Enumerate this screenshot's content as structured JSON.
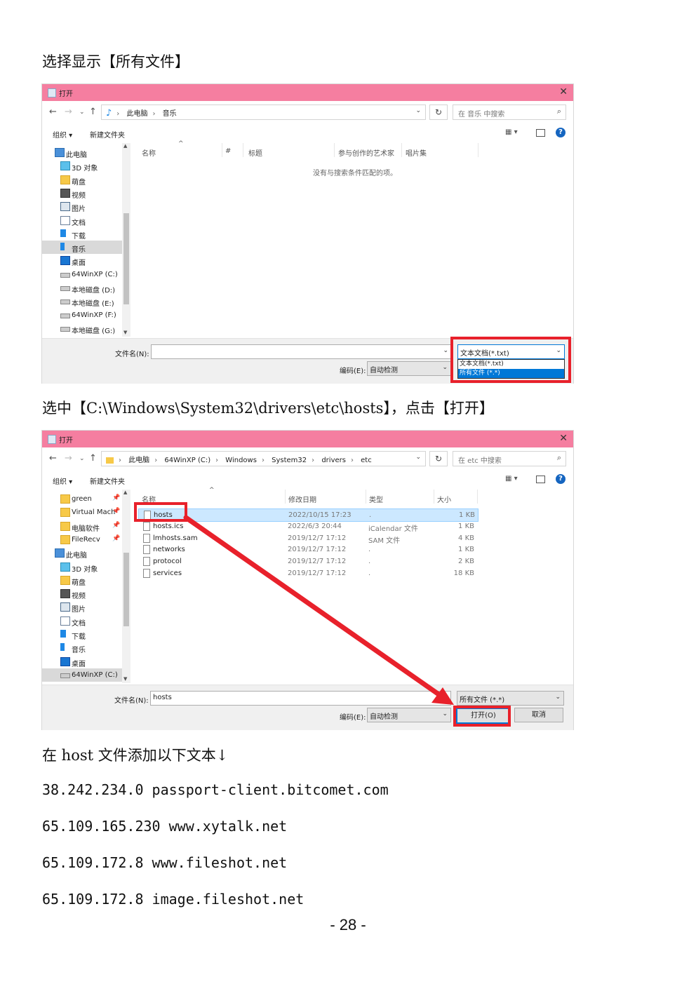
{
  "captions": {
    "c1": "选择显示【所有文件】",
    "c2": "选中【C:\\Windows\\System32\\drivers\\etc\\hosts】，点击【打开】",
    "c3": "在 host 文件添加以下文本↓"
  },
  "host_lines": [
    "38.242.234.0 passport-client.bitcomet.com",
    "65.109.165.230 www.xytalk.net",
    "65.109.172.8 www.fileshot.net",
    "65.109.172.8 image.fileshot.net"
  ],
  "page_number": "- 28 -",
  "colors": {
    "titlebar": "#f57ea0",
    "highlight_box": "#e8212b",
    "selection": "#0078d7"
  },
  "dialog1": {
    "title": "打开",
    "close": "✕",
    "nav": {
      "back": "←",
      "forward": "→",
      "recent": "⌄",
      "up": "↑"
    },
    "path": [
      "此电脑",
      "音乐"
    ],
    "refresh": "↻",
    "search_placeholder": "在 音乐 中搜索",
    "toolbar": {
      "organize": "组织 ▾",
      "new_folder": "新建文件夹",
      "views": "▦ ▾",
      "help": "?"
    },
    "sidebar": [
      {
        "label": "此电脑",
        "icon": "computer-icon"
      },
      {
        "label": "3D 对象",
        "icon": "cube-icon"
      },
      {
        "label": "萌盘",
        "icon": "folder-icon"
      },
      {
        "label": "视频",
        "icon": "video-icon"
      },
      {
        "label": "图片",
        "icon": "picture-icon"
      },
      {
        "label": "文档",
        "icon": "document-icon"
      },
      {
        "label": "下载",
        "icon": "download-icon"
      },
      {
        "label": "音乐",
        "icon": "music-icon",
        "selected": true
      },
      {
        "label": "桌面",
        "icon": "desktop-icon"
      },
      {
        "label": "64WinXP  (C:)",
        "icon": "drive-icon"
      },
      {
        "label": "本地磁盘 (D:)",
        "icon": "drive-icon"
      },
      {
        "label": "本地磁盘 (E:)",
        "icon": "drive-icon"
      },
      {
        "label": "64WinXP  (F:)",
        "icon": "drive-icon"
      },
      {
        "label": "本地磁盘 (G:)",
        "icon": "drive-icon"
      }
    ],
    "columns": [
      "名称",
      "#",
      "标题",
      "参与创作的艺术家",
      "唱片集"
    ],
    "empty_message": "没有与搜索条件匹配的项。",
    "filename_label": "文件名(N):",
    "filename_value": "",
    "filetype_value": "文本文档(*.txt)",
    "filetype_options": [
      "文本文档(*.txt)",
      "所有文件  (*.*)"
    ],
    "encoding_label": "编码(E):",
    "encoding_value": "自动检测"
  },
  "dialog2": {
    "title": "打开",
    "close": "✕",
    "nav": {
      "back": "←",
      "forward": "→",
      "recent": "⌄",
      "up": "↑"
    },
    "path": [
      "此电脑",
      "64WinXP  (C:)",
      "Windows",
      "System32",
      "drivers",
      "etc"
    ],
    "refresh": "↻",
    "search_placeholder": "在 etc 中搜索",
    "toolbar": {
      "organize": "组织 ▾",
      "new_folder": "新建文件夹",
      "views": "▦ ▾",
      "help": "?"
    },
    "sidebar": [
      {
        "label": "green",
        "icon": "folder-icon",
        "pinned": true
      },
      {
        "label": "Virtual Mach",
        "icon": "folder-icon",
        "pinned": true
      },
      {
        "label": "电脑软件",
        "icon": "folder-icon",
        "pinned": true
      },
      {
        "label": "FileRecv",
        "icon": "folder-icon",
        "pinned": true
      },
      {
        "label": "此电脑",
        "icon": "computer-icon"
      },
      {
        "label": "3D 对象",
        "icon": "cube-icon"
      },
      {
        "label": "萌盘",
        "icon": "folder-icon"
      },
      {
        "label": "视频",
        "icon": "video-icon"
      },
      {
        "label": "图片",
        "icon": "picture-icon"
      },
      {
        "label": "文档",
        "icon": "document-icon"
      },
      {
        "label": "下载",
        "icon": "download-icon"
      },
      {
        "label": "音乐",
        "icon": "music-icon"
      },
      {
        "label": "桌面",
        "icon": "desktop-icon"
      },
      {
        "label": "64WinXP  (C:)",
        "icon": "drive-icon",
        "selected": true
      }
    ],
    "pin_glyph": "📌",
    "columns": [
      "名称",
      "修改日期",
      "类型",
      "大小"
    ],
    "files": [
      {
        "name": "hosts",
        "date": "2022/10/15 17:23",
        "type": ".",
        "size": "1 KB",
        "selected": true
      },
      {
        "name": "hosts.ics",
        "date": "2022/6/3 20:44",
        "type": "iCalendar 文件",
        "size": "1 KB"
      },
      {
        "name": "lmhosts.sam",
        "date": "2019/12/7 17:12",
        "type": "SAM 文件",
        "size": "4 KB"
      },
      {
        "name": "networks",
        "date": "2019/12/7 17:12",
        "type": ".",
        "size": "1 KB"
      },
      {
        "name": "protocol",
        "date": "2019/12/7 17:12",
        "type": ".",
        "size": "2 KB"
      },
      {
        "name": "services",
        "date": "2019/12/7 17:12",
        "type": ".",
        "size": "18 KB"
      }
    ],
    "filename_label": "文件名(N):",
    "filename_value": "hosts",
    "filetype_value": "所有文件  (*.*)",
    "encoding_label": "编码(E):",
    "encoding_value": "自动检测",
    "open_button": "打开(O)",
    "cancel_button": "取消"
  }
}
